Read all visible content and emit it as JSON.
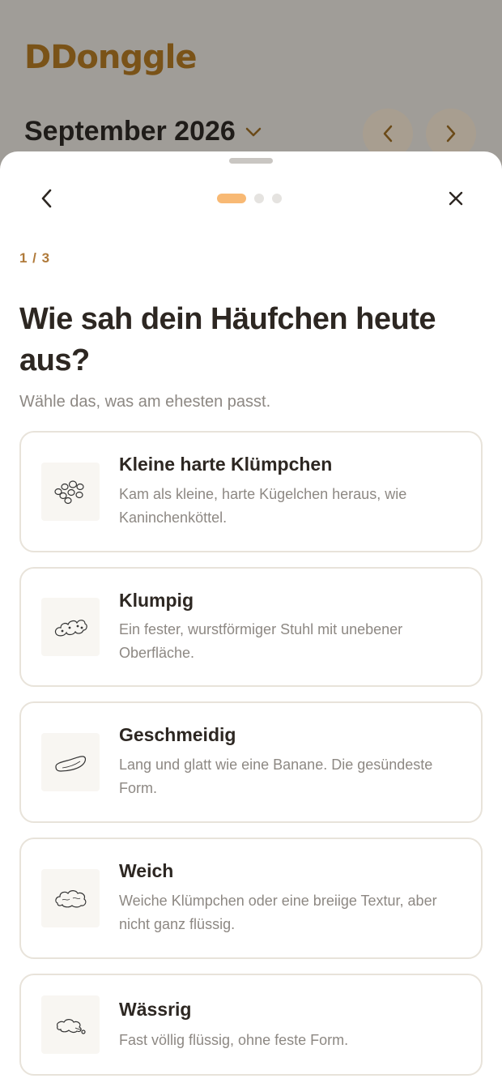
{
  "background": {
    "logo": "DDonggle",
    "month_label": "September 2026",
    "month_chevron_icon": "chevron-down-icon",
    "prev_icon": "chevron-left-icon",
    "next_icon": "chevron-right-icon"
  },
  "sheet": {
    "back_icon": "chevron-left-icon",
    "close_icon": "close-icon",
    "progress": {
      "current": 1,
      "total": 3
    },
    "step_label": "1 / 3",
    "title": "Wie sah dein Häufchen heute aus?",
    "subtitle": "Wähle das, was am ehesten passt.",
    "options": [
      {
        "icon": "pellets-icon",
        "title": "Kleine harte Klümpchen",
        "description": "Kam als kleine, harte Kügelchen heraus, wie Kaninchenköttel."
      },
      {
        "icon": "lumpy-log-icon",
        "title": "Klumpig",
        "description": "Ein fester, wurstförmiger Stuhl mit unebener Oberfläche."
      },
      {
        "icon": "smooth-banana-icon",
        "title": "Geschmeidig",
        "description": "Lang und glatt wie eine Banane. Die gesündeste Form."
      },
      {
        "icon": "soft-blob-icon",
        "title": "Weich",
        "description": "Weiche Klümpchen oder eine breiige Textur, aber nicht ganz flüssig."
      },
      {
        "icon": "watery-puddle-icon",
        "title": "Wässrig",
        "description": "Fast völlig flüssig, ohne feste Form."
      }
    ]
  },
  "colors": {
    "accent": "#f8b974",
    "step_label": "#b07a3a",
    "brand": "#7a5318",
    "card_border": "#e8e3da"
  }
}
